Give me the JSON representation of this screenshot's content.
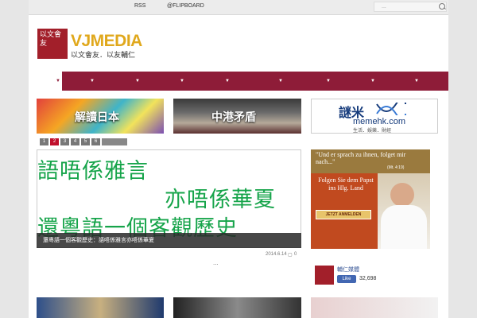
{
  "topbar": {
    "rss": "RSS",
    "flipboard": "@FLIPBOARD",
    "search_placeholder": "..."
  },
  "logo": {
    "seal": "以文會友",
    "name": "VJMEDIA",
    "tagline": "以文會友．以友輔仁"
  },
  "nav": {
    "arrow": "▼"
  },
  "tiles": [
    {
      "label": "解讀日本"
    },
    {
      "label": "中港矛盾"
    }
  ],
  "memehk": {
    "title": "memehk.com",
    "sub": "生活．娛樂．財經",
    "cn": "謎米"
  },
  "pager": [
    "1",
    "2",
    "3",
    "4",
    "5",
    "6"
  ],
  "slide": {
    "line1": "語唔係雅言",
    "line2": "亦唔係華夏",
    "line3": "還粵語一個客觀歷史",
    "caption": "還粵語一個客觀歷史：語唔係雅言亦唔係華夏",
    "date": "2014.6.14",
    "comments": "0",
    "more": "..."
  },
  "ad": {
    "quote": "\"Und er sprach zu ihnen, folget mir nach...\"",
    "ref": "(Mt. 4:19)",
    "follow": "Folgen Sie dem Papst ins Hlg. Land",
    "button": "JETZT ANMELDEN"
  },
  "fb": {
    "name": "輔仁媒體",
    "like": "Like",
    "count": "32,698"
  }
}
